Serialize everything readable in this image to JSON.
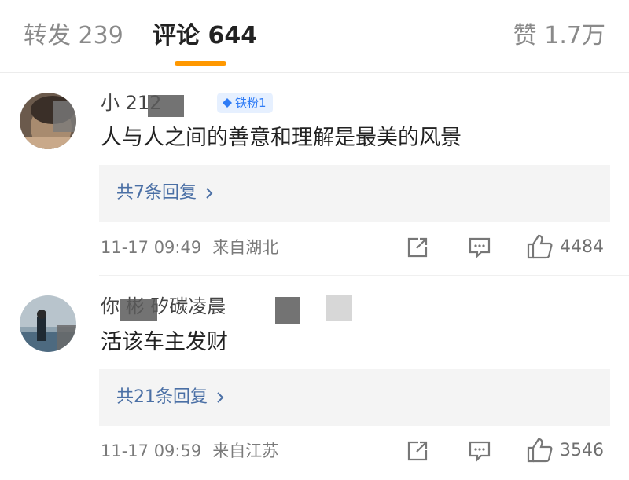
{
  "tabs": {
    "repost": "转发 239",
    "comments": "评论 644",
    "likes": "赞 1.7万"
  },
  "comments": [
    {
      "username": "小      212",
      "badge": "铁粉1",
      "text": "人与人之间的善意和理解是最美的风景",
      "replies": "共7条回复",
      "time": "11-17 09:49",
      "location": "来自湖北",
      "likes": "4484"
    },
    {
      "username": "你      彬 矽碳凌晨",
      "text": "活该车主发财",
      "replies": "共21条回复",
      "time": "11-17 09:59",
      "location": "来自江苏",
      "likes": "3546"
    }
  ],
  "colors": {
    "accent": "#ff9800",
    "link": "#4a6fa5",
    "badge": "#2f7cf6"
  }
}
